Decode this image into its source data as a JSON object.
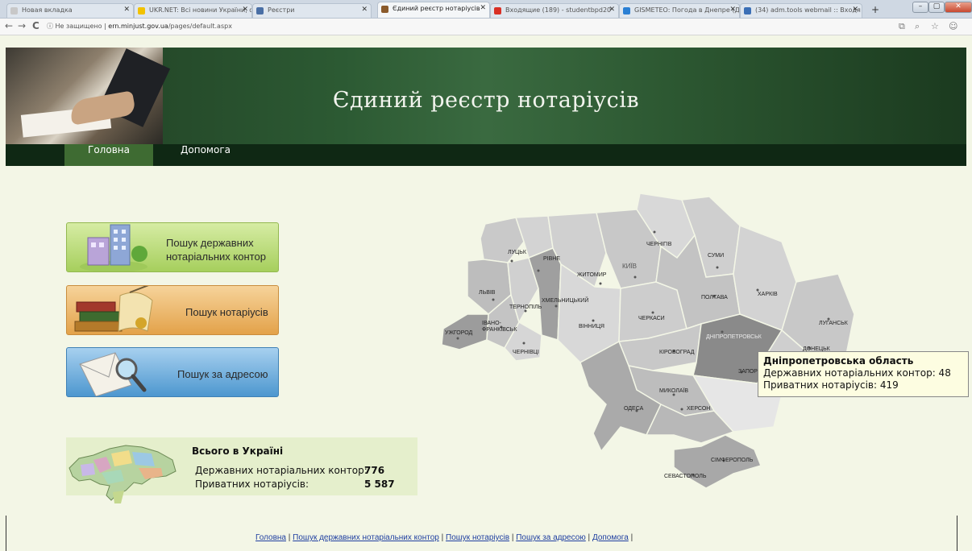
{
  "browser": {
    "tabs": [
      {
        "title": "Новая вкладка",
        "fav": "#c8c8c8"
      },
      {
        "title": "UKR.NET: Всі новини України, о",
        "fav": "#f2c200"
      },
      {
        "title": "Реєстри",
        "fav": "#4a6fa5"
      },
      {
        "title": "Єдиний реєстр нотаріусів",
        "fav": "#8a5a2b"
      },
      {
        "title": "Входящие (189) - studentbpd20",
        "fav": "#d93025"
      },
      {
        "title": "GISMETEO: Погода в Днепре (Д",
        "fav": "#2a7fd4"
      },
      {
        "title": "(34) adm.tools webmail :: Входя",
        "fav": "#3b6fb6"
      }
    ],
    "new_tab": "+",
    "nav": {
      "back": "←",
      "forward": "→",
      "reload": "C"
    },
    "url_prefix": "ⓘ Не защищено",
    "url_host": "ern.minjust.gov.ua",
    "url_path": "/pages/default.aspx",
    "right_icons": [
      "⧉",
      "⌕",
      "☆",
      "☺"
    ],
    "window_controls": [
      "–",
      "▢",
      "✕"
    ]
  },
  "header": {
    "title": "Єдиний реєстр нотаріусів"
  },
  "menu": {
    "items": [
      "Головна",
      "Допомога"
    ]
  },
  "actions": [
    {
      "label_line1": "Пошук державних",
      "label_line2": "нотаріальних контор"
    },
    {
      "label_line1": "Пошук нотаріусів",
      "label_line2": ""
    },
    {
      "label_line1": "Пошук за адресою",
      "label_line2": ""
    }
  ],
  "totals": {
    "title": "Всього в Україні",
    "rows": [
      {
        "label": "Державних нотаріальних контор:",
        "value": "776"
      },
      {
        "label": "Приватних нотаріусів:",
        "value": "5 587"
      }
    ]
  },
  "map": {
    "cities": [
      "ЛУЦЬК",
      "РІВНЕ",
      "ЖИТОМИР",
      "КИЇВ",
      "ЧЕРНІГІВ",
      "СУМИ",
      "ЛЬВІВ",
      "ТЕРНОПІЛЬ",
      "ХМЕЛЬНИЦЬКИЙ",
      "ІВАНО-ФРАНКІВСЬК",
      "УЖГОРОД",
      "ЧЕРНІВЦІ",
      "ВІННИЦЯ",
      "ЧЕРКАСИ",
      "ПОЛТАВА",
      "ХАРКІВ",
      "ЛУГАНСЬК",
      "ДНІПРОПЕТРОВСЬК",
      "ДОНЕЦЬК",
      "КІРОВОГРАД",
      "ЗАПОРІЖЖЯ",
      "МИКОЛАЇВ",
      "ОДЕСА",
      "ХЕРСОН",
      "СІМФЕРОПОЛЬ",
      "СЕВАСТОПОЛЬ"
    ],
    "highlight_color": "#8a8a8a"
  },
  "tooltip": {
    "title": "Дніпропетровська область",
    "line1": "Державних нотаріальних контор: 48",
    "line2": "Приватних нотаріусів: 419"
  },
  "footer": {
    "links": [
      "Головна",
      "Пошук державних нотаріальних контор",
      "Пошук нотаріусів",
      "Пошук за адресою",
      "Допомога"
    ],
    "separator": "|"
  }
}
